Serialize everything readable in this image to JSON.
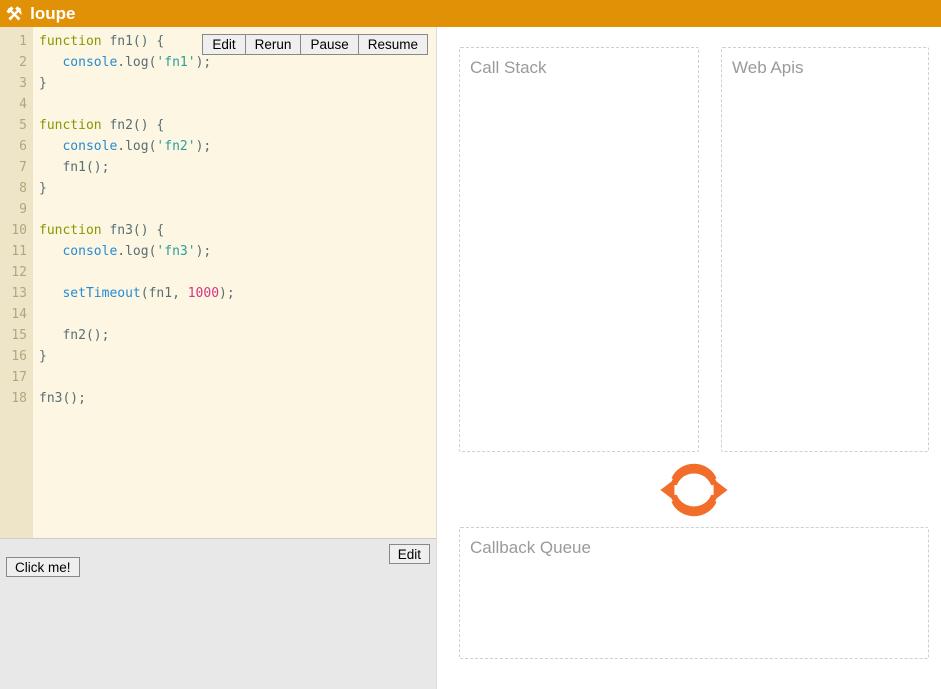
{
  "header": {
    "title": "loupe",
    "logo": "⚒"
  },
  "toolbar": {
    "edit": "Edit",
    "rerun": "Rerun",
    "pause": "Pause",
    "resume": "Resume"
  },
  "bottom": {
    "clickme": "Click me!",
    "edit": "Edit"
  },
  "panels": {
    "call_stack": "Call Stack",
    "web_apis": "Web Apis",
    "callback_queue": "Callback Queue"
  },
  "code_lines": [
    "function fn1() {",
    "   console.log('fn1');",
    "}",
    "",
    "function fn2() {",
    "   console.log('fn2');",
    "   fn1();",
    "}",
    "",
    "function fn3() {",
    "   console.log('fn3');",
    "",
    "   setTimeout(fn1, 1000);",
    "",
    "   fn2();",
    "}",
    "",
    "fn3();"
  ]
}
